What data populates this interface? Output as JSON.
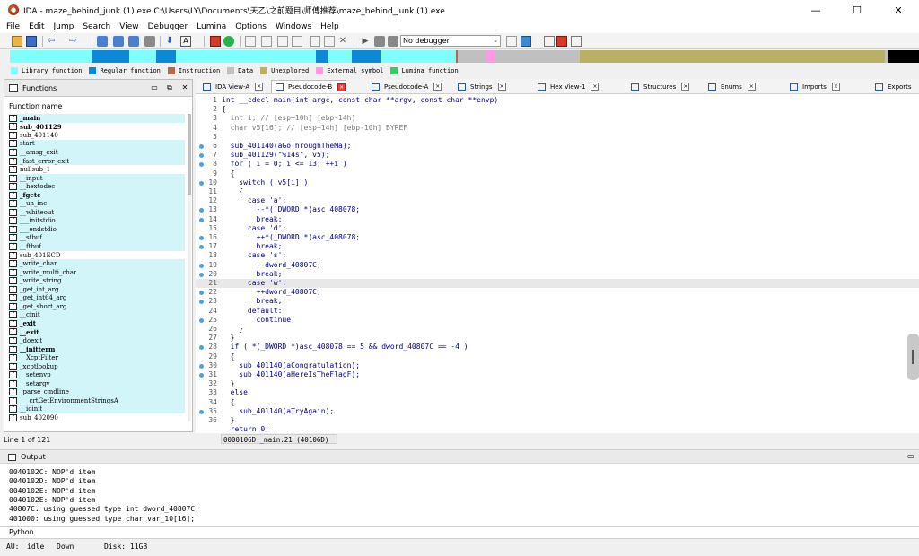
{
  "window": {
    "title": "IDA - maze_behind_junk (1).exe C:\\Users\\LY\\Documents\\天乙\\之前题目\\师傅推荐\\maze_behind_junk (1).exe",
    "minimize": "—",
    "maximize": "☐",
    "close": "✕"
  },
  "menu": [
    "File",
    "Edit",
    "Jump",
    "Search",
    "View",
    "Debugger",
    "Lumina",
    "Options",
    "Windows",
    "Help"
  ],
  "toolbar": {
    "debugger_select": "No debugger"
  },
  "legend": [
    {
      "label": "Library function",
      "color": "#80ffff"
    },
    {
      "label": "Regular function",
      "color": "#0a8ad6"
    },
    {
      "label": "Instruction",
      "color": "#b46848"
    },
    {
      "label": "Data",
      "color": "#c0c0c0"
    },
    {
      "label": "Unexplored",
      "color": "#b8b063"
    },
    {
      "label": "External symbol",
      "color": "#ff99e6"
    },
    {
      "label": "Lumina function",
      "color": "#33cc66"
    }
  ],
  "functions_panel": {
    "title": "Functions",
    "column": "Function name",
    "items": [
      {
        "name": "_main",
        "bold": true,
        "bg": "lib"
      },
      {
        "name": "sub_401129",
        "bold": true,
        "bg": "reg"
      },
      {
        "name": "sub_401140",
        "bold": false,
        "bg": "reg"
      },
      {
        "name": "start",
        "bold": false,
        "bg": "lib"
      },
      {
        "name": "__amsg_exit",
        "bold": false,
        "bg": "lib"
      },
      {
        "name": "_fast_error_exit",
        "bold": false,
        "bg": "lib"
      },
      {
        "name": "nullsub_1",
        "bold": false,
        "bg": "reg"
      },
      {
        "name": "__input",
        "bold": false,
        "bg": "lib"
      },
      {
        "name": "__hextodec",
        "bold": false,
        "bg": "lib"
      },
      {
        "name": "_fgetc",
        "bold": true,
        "bg": "lib"
      },
      {
        "name": "__un_inc",
        "bold": false,
        "bg": "lib"
      },
      {
        "name": "__whiteout",
        "bold": false,
        "bg": "lib"
      },
      {
        "name": "___initstdio",
        "bold": false,
        "bg": "lib"
      },
      {
        "name": "___endstdio",
        "bold": false,
        "bg": "lib"
      },
      {
        "name": "__stbuf",
        "bold": false,
        "bg": "lib"
      },
      {
        "name": "__ftbuf",
        "bold": false,
        "bg": "lib"
      },
      {
        "name": "sub_401ECD",
        "bold": false,
        "bg": "reg"
      },
      {
        "name": "_write_char",
        "bold": false,
        "bg": "lib"
      },
      {
        "name": "_write_multi_char",
        "bold": false,
        "bg": "lib"
      },
      {
        "name": "_write_string",
        "bold": false,
        "bg": "lib"
      },
      {
        "name": "_get_int_arg",
        "bold": false,
        "bg": "lib"
      },
      {
        "name": "_get_int64_arg",
        "bold": false,
        "bg": "lib"
      },
      {
        "name": "_get_short_arg",
        "bold": false,
        "bg": "lib"
      },
      {
        "name": "__cinit",
        "bold": false,
        "bg": "lib"
      },
      {
        "name": "_exit",
        "bold": true,
        "bg": "lib"
      },
      {
        "name": "__exit",
        "bold": true,
        "bg": "lib"
      },
      {
        "name": "_doexit",
        "bold": false,
        "bg": "lib"
      },
      {
        "name": "__initterm",
        "bold": true,
        "bg": "lib"
      },
      {
        "name": "__XcptFilter",
        "bold": false,
        "bg": "lib"
      },
      {
        "name": "_xcptlookup",
        "bold": false,
        "bg": "lib"
      },
      {
        "name": "__setenvp",
        "bold": false,
        "bg": "lib"
      },
      {
        "name": "__setargv",
        "bold": false,
        "bg": "lib"
      },
      {
        "name": "_parse_cmdline",
        "bold": false,
        "bg": "lib"
      },
      {
        "name": "___crtGetEnvironmentStringsA",
        "bold": false,
        "bg": "lib"
      },
      {
        "name": "__ioinit",
        "bold": false,
        "bg": "lib"
      },
      {
        "name": "sub_402090",
        "bold": false,
        "bg": "reg"
      }
    ],
    "status": "Line 1 of 121"
  },
  "tabs": [
    {
      "label": "IDA View-A",
      "active": false
    },
    {
      "label": "Pseudocode-B",
      "active": true
    },
    {
      "label": "Pseudocode-A",
      "active": false
    },
    {
      "label": "Strings",
      "active": false
    },
    {
      "label": "Hex View-1",
      "active": false
    },
    {
      "label": "Structures",
      "active": false
    },
    {
      "label": "Enums",
      "active": false
    },
    {
      "label": "Imports",
      "active": false
    },
    {
      "label": "Exports",
      "active": false
    }
  ],
  "code": [
    {
      "n": "1",
      "t": "int __cdecl main(int argc, const char **argv, const char **envp)",
      "dot": false,
      "k": "n"
    },
    {
      "n": "2",
      "t": "{",
      "dot": false,
      "k": "b"
    },
    {
      "n": "3",
      "t": "  int i; // [esp+10h] [ebp-14h]",
      "dot": false,
      "k": "c"
    },
    {
      "n": "4",
      "t": "  char v5[16]; // [esp+14h] [ebp-10h] BYREF",
      "dot": false,
      "k": "c"
    },
    {
      "n": "5",
      "t": "",
      "dot": false,
      "k": "n"
    },
    {
      "n": "6",
      "t": "  sub_401140(aGoThroughTheMa);",
      "dot": true,
      "k": "n"
    },
    {
      "n": "7",
      "t": "  sub_401129(\"%14s\", v5);",
      "dot": true,
      "k": "n"
    },
    {
      "n": "8",
      "t": "  for ( i = 0; i <= 13; ++i )",
      "dot": true,
      "k": "n"
    },
    {
      "n": "9",
      "t": "  {",
      "dot": false,
      "k": "b"
    },
    {
      "n": "10",
      "t": "    switch ( v5[i] )",
      "dot": true,
      "k": "n"
    },
    {
      "n": "11",
      "t": "    {",
      "dot": false,
      "k": "b"
    },
    {
      "n": "12",
      "t": "      case 'a':",
      "dot": false,
      "k": "n"
    },
    {
      "n": "13",
      "t": "        --*(_DWORD *)asc_408078;",
      "dot": true,
      "k": "n"
    },
    {
      "n": "14",
      "t": "        break;",
      "dot": true,
      "k": "n"
    },
    {
      "n": "15",
      "t": "      case 'd':",
      "dot": false,
      "k": "n"
    },
    {
      "n": "16",
      "t": "        ++*(_DWORD *)asc_408078;",
      "dot": true,
      "k": "n"
    },
    {
      "n": "17",
      "t": "        break;",
      "dot": true,
      "k": "n"
    },
    {
      "n": "18",
      "t": "      case 's':",
      "dot": false,
      "k": "n"
    },
    {
      "n": "19",
      "t": "        --dword_40807C;",
      "dot": true,
      "k": "n"
    },
    {
      "n": "20",
      "t": "        break;",
      "dot": true,
      "k": "n"
    },
    {
      "n": "21",
      "t": "      case 'w':",
      "dot": false,
      "k": "n",
      "hl": true
    },
    {
      "n": "22",
      "t": "        ++dword_40807C;",
      "dot": true,
      "k": "n"
    },
    {
      "n": "23",
      "t": "        break;",
      "dot": true,
      "k": "n"
    },
    {
      "n": "24",
      "t": "      default:",
      "dot": false,
      "k": "n"
    },
    {
      "n": "25",
      "t": "        continue;",
      "dot": true,
      "k": "n"
    },
    {
      "n": "26",
      "t": "    }",
      "dot": false,
      "k": "b"
    },
    {
      "n": "27",
      "t": "  }",
      "dot": false,
      "k": "b"
    },
    {
      "n": "28",
      "t": "  if ( *(_DWORD *)asc_408078 == 5 && dword_40807C == -4 )",
      "dot": true,
      "k": "n"
    },
    {
      "n": "29",
      "t": "  {",
      "dot": false,
      "k": "b"
    },
    {
      "n": "30",
      "t": "    sub_401140(aCongratulation);",
      "dot": true,
      "k": "n"
    },
    {
      "n": "31",
      "t": "    sub_401140(aHereIsTheFlagF);",
      "dot": true,
      "k": "n"
    },
    {
      "n": "32",
      "t": "  }",
      "dot": false,
      "k": "b"
    },
    {
      "n": "33",
      "t": "  else",
      "dot": false,
      "k": "n"
    },
    {
      "n": "34",
      "t": "  {",
      "dot": false,
      "k": "b"
    },
    {
      "n": "35",
      "t": "    sub_401140(aTryAgain);",
      "dot": true,
      "k": "n"
    },
    {
      "n": "36",
      "t": "  }",
      "dot": false,
      "k": "b"
    },
    {
      "n": "",
      "t": "  return 0;",
      "dot": false,
      "k": "n"
    }
  ],
  "editor_status": "0000106D _main:21 (40106D)",
  "output": {
    "title": "Output",
    "lines": [
      "0040102C: NOP'd item",
      "0040102D: NOP'd item",
      "0040102E: NOP'd item",
      "0040102E: NOP'd item",
      "40807C: using guessed type int dword_40807C;",
      "401000: using guessed type char var_10[16];"
    ]
  },
  "python_label": "Python",
  "statusbar": {
    "au": "AU:",
    "state": "idle",
    "direction": "Down",
    "disk": "Disk: 11GB"
  }
}
